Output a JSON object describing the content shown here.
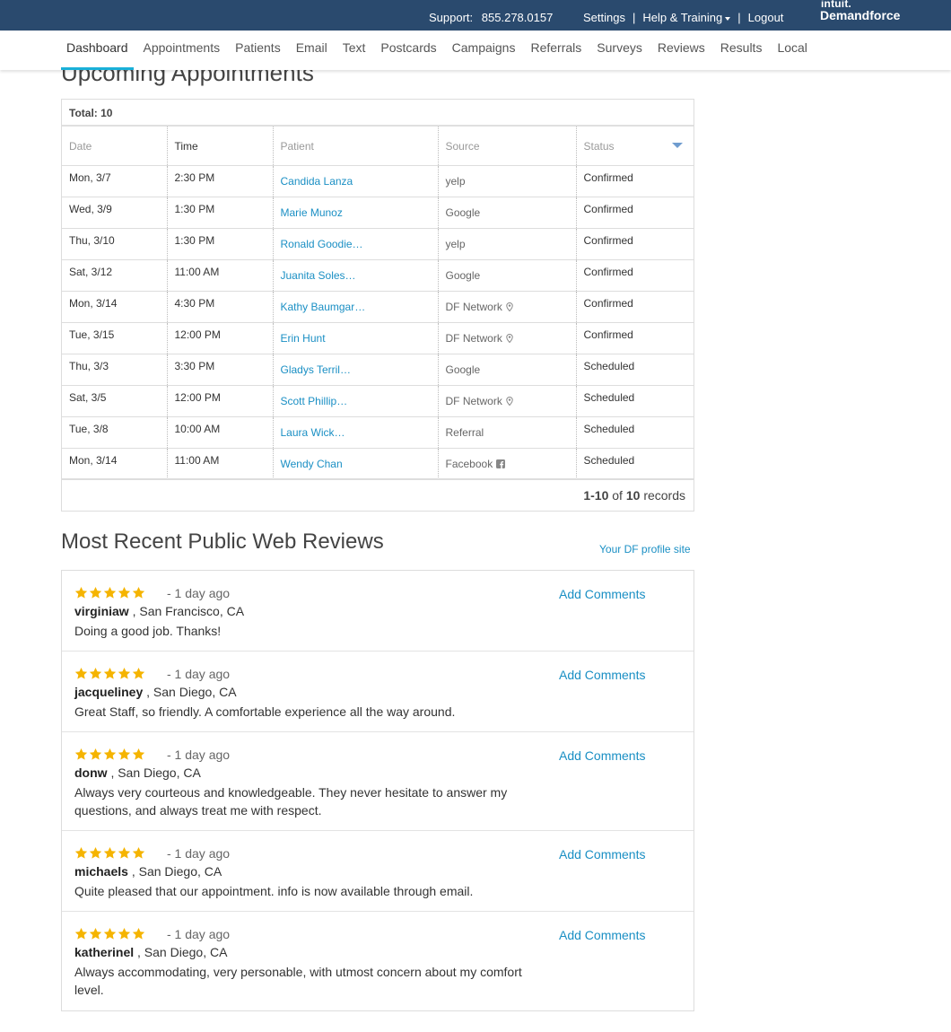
{
  "topbar": {
    "support_label": "Support:",
    "support_phone": "855.278.0157",
    "settings": "Settings",
    "help": "Help & Training",
    "logout": "Logout",
    "brand_top": "intuit.",
    "brand_name": "Demandforce"
  },
  "nav": {
    "items": [
      "Dashboard",
      "Appointments",
      "Patients",
      "Email",
      "Text",
      "Postcards",
      "Campaigns",
      "Referrals",
      "Surveys",
      "Reviews",
      "Results",
      "Local"
    ],
    "active": "Dashboard"
  },
  "appointments": {
    "title": "Upcoming Appointments",
    "total_label": "Total: 10",
    "columns": [
      "Date",
      "Time",
      "Patient",
      "Source",
      "Status"
    ],
    "rows": [
      {
        "date": "Mon, 3/7",
        "time": "2:30 PM",
        "patient": "Candida Lanza",
        "source": "yelp",
        "source_icon": "",
        "status": "Confirmed"
      },
      {
        "date": "Wed, 3/9",
        "time": "1:30 PM",
        "patient": "Marie Munoz",
        "source": "Google",
        "source_icon": "",
        "status": "Confirmed"
      },
      {
        "date": "Thu, 3/10",
        "time": "1:30 PM",
        "patient": "Ronald Goodie…",
        "source": "yelp",
        "source_icon": "",
        "status": "Confirmed"
      },
      {
        "date": "Sat, 3/12",
        "time": "11:00 AM",
        "patient": "Juanita Soles…",
        "source": "Google",
        "source_icon": "",
        "status": "Confirmed"
      },
      {
        "date": "Mon, 3/14",
        "time": "4:30 PM",
        "patient": "Kathy Baumgar…",
        "source": "DF Network",
        "source_icon": "pin-icon",
        "status": "Confirmed"
      },
      {
        "date": "Tue, 3/15",
        "time": "12:00 PM",
        "patient": "Erin Hunt",
        "source": "DF Network",
        "source_icon": "pin-icon",
        "status": "Confirmed"
      },
      {
        "date": "Thu, 3/3",
        "time": "3:30 PM",
        "patient": "Gladys Terril…",
        "source": "Google",
        "source_icon": "",
        "status": "Scheduled"
      },
      {
        "date": "Sat, 3/5",
        "time": "12:00 PM",
        "patient": "Scott Phillip…",
        "source": "DF Network",
        "source_icon": "pin-icon",
        "status": "Scheduled"
      },
      {
        "date": "Tue, 3/8",
        "time": "10:00 AM",
        "patient": "Laura Wick…",
        "source": "Referral",
        "source_icon": "",
        "status": "Scheduled"
      },
      {
        "date": "Mon, 3/14",
        "time": "11:00 AM",
        "patient": "Wendy Chan",
        "source": "Facebook",
        "source_icon": "facebook-icon",
        "status": "Scheduled"
      }
    ],
    "pager": {
      "range": "1-10",
      "of": "of",
      "count": "10",
      "suffix": "records"
    }
  },
  "reviews": {
    "title": "Most Recent Public Web Reviews",
    "profile_link": "Your DF profile site",
    "star_color": "#f5b400",
    "items": [
      {
        "rating": 5,
        "ago": "- 1 day ago",
        "user": "virginiaw",
        "location": ", San Francisco, CA",
        "text": "Doing a good job. Thanks!",
        "action": "Add Comments"
      },
      {
        "rating": 5,
        "ago": "- 1 day ago",
        "user": "jacqueliney",
        "location": ", San Diego, CA",
        "text": "Great Staff, so friendly. A comfortable experience all the way around.",
        "action": "Add Comments"
      },
      {
        "rating": 5,
        "ago": "- 1 day ago",
        "user": "donw",
        "location": ", San Diego, CA",
        "text": "Always very courteous and knowledgeable. They never hesitate to answer my questions, and always treat me with respect.",
        "action": "Add Comments"
      },
      {
        "rating": 5,
        "ago": "- 1 day ago",
        "user": "michaels",
        "location": ", San Diego, CA",
        "text": "Quite pleased that our appointment. info is now available through email.",
        "action": "Add Comments"
      },
      {
        "rating": 5,
        "ago": "- 1 day ago",
        "user": "katherinel",
        "location": ", San Diego, CA",
        "text": "Always accommodating, very personable, with utmost concern about my comfort level.",
        "action": "Add Comments"
      }
    ]
  }
}
